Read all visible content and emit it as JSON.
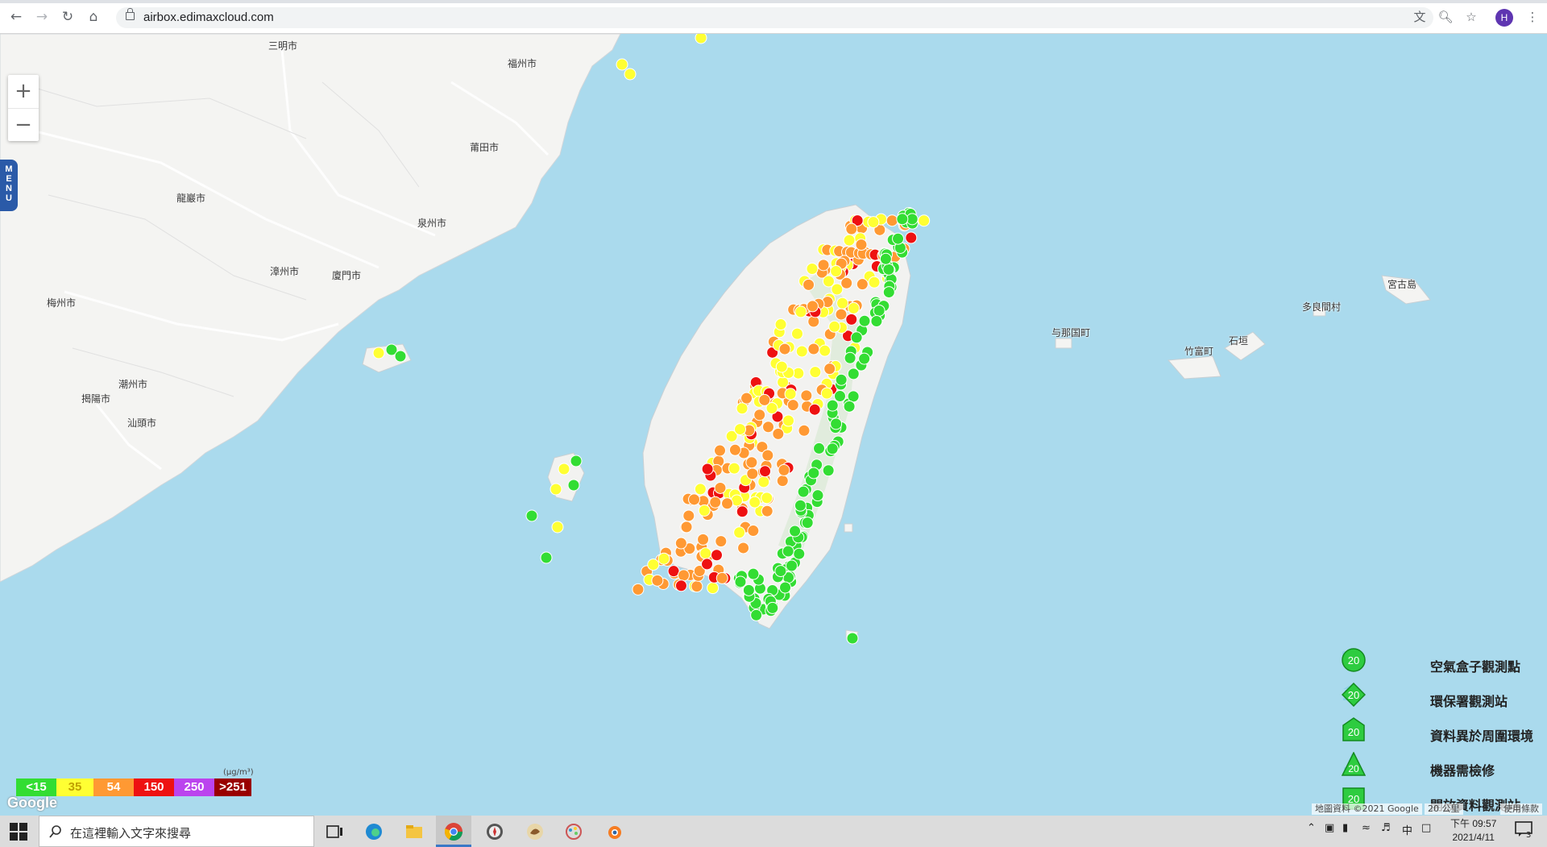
{
  "browser": {
    "url": "airbox.edimaxcloud.com",
    "profile_initial": "H"
  },
  "map": {
    "zoom_in": "+",
    "zoom_out": "−",
    "menu_label": "MENU",
    "places": [
      {
        "name": "三明市"
      },
      {
        "name": "福州市"
      },
      {
        "name": "莆田市"
      },
      {
        "name": "龍巖市"
      },
      {
        "name": "泉州市"
      },
      {
        "name": "漳州市"
      },
      {
        "name": "廈門市"
      },
      {
        "name": "梅州市"
      },
      {
        "name": "潮州市"
      },
      {
        "name": "揭陽市"
      },
      {
        "name": "汕頭市"
      },
      {
        "name": "宮古島"
      },
      {
        "name": "多良間村"
      },
      {
        "name": "与那国町"
      },
      {
        "name": "竹富町"
      },
      {
        "name": "石垣"
      }
    ],
    "map_marker_notes": "Air quality markers are PM2.5 readings in μg/m³ shown over Taiwan"
  },
  "legend": {
    "items": [
      {
        "label": "空氣盒子觀測點",
        "value": "20",
        "shape": "circle"
      },
      {
        "label": "環保署觀測站",
        "value": "20",
        "shape": "diamond"
      },
      {
        "label": "資料異於周圍環境",
        "value": "20",
        "shape": "house"
      },
      {
        "label": "機器需檢修",
        "value": "20",
        "shape": "triangle"
      },
      {
        "label": "開放資料觀測站",
        "value": "20",
        "shape": "square"
      }
    ]
  },
  "aqi_scale": {
    "unit": "(μg/m³)",
    "levels": [
      {
        "label": "<15",
        "color": "#33dd33"
      },
      {
        "label": "35",
        "color": "#ffff33"
      },
      {
        "label": "54",
        "color": "#ff9933"
      },
      {
        "label": "150",
        "color": "#ee1111"
      },
      {
        "label": "250",
        "color": "#bb44ee"
      },
      {
        "label": ">251",
        "color": "#990000"
      }
    ]
  },
  "attribution": {
    "google": "Google",
    "map_data": "地圖資料 ©2021 Google",
    "scale_text": "20 公里",
    "terms": "使用條款"
  },
  "taskbar": {
    "search_placeholder": "在這裡輸入文字來搜尋",
    "time": "下午 09:57",
    "date": "2021/4/11",
    "ime": "中",
    "notification_count": "3"
  }
}
